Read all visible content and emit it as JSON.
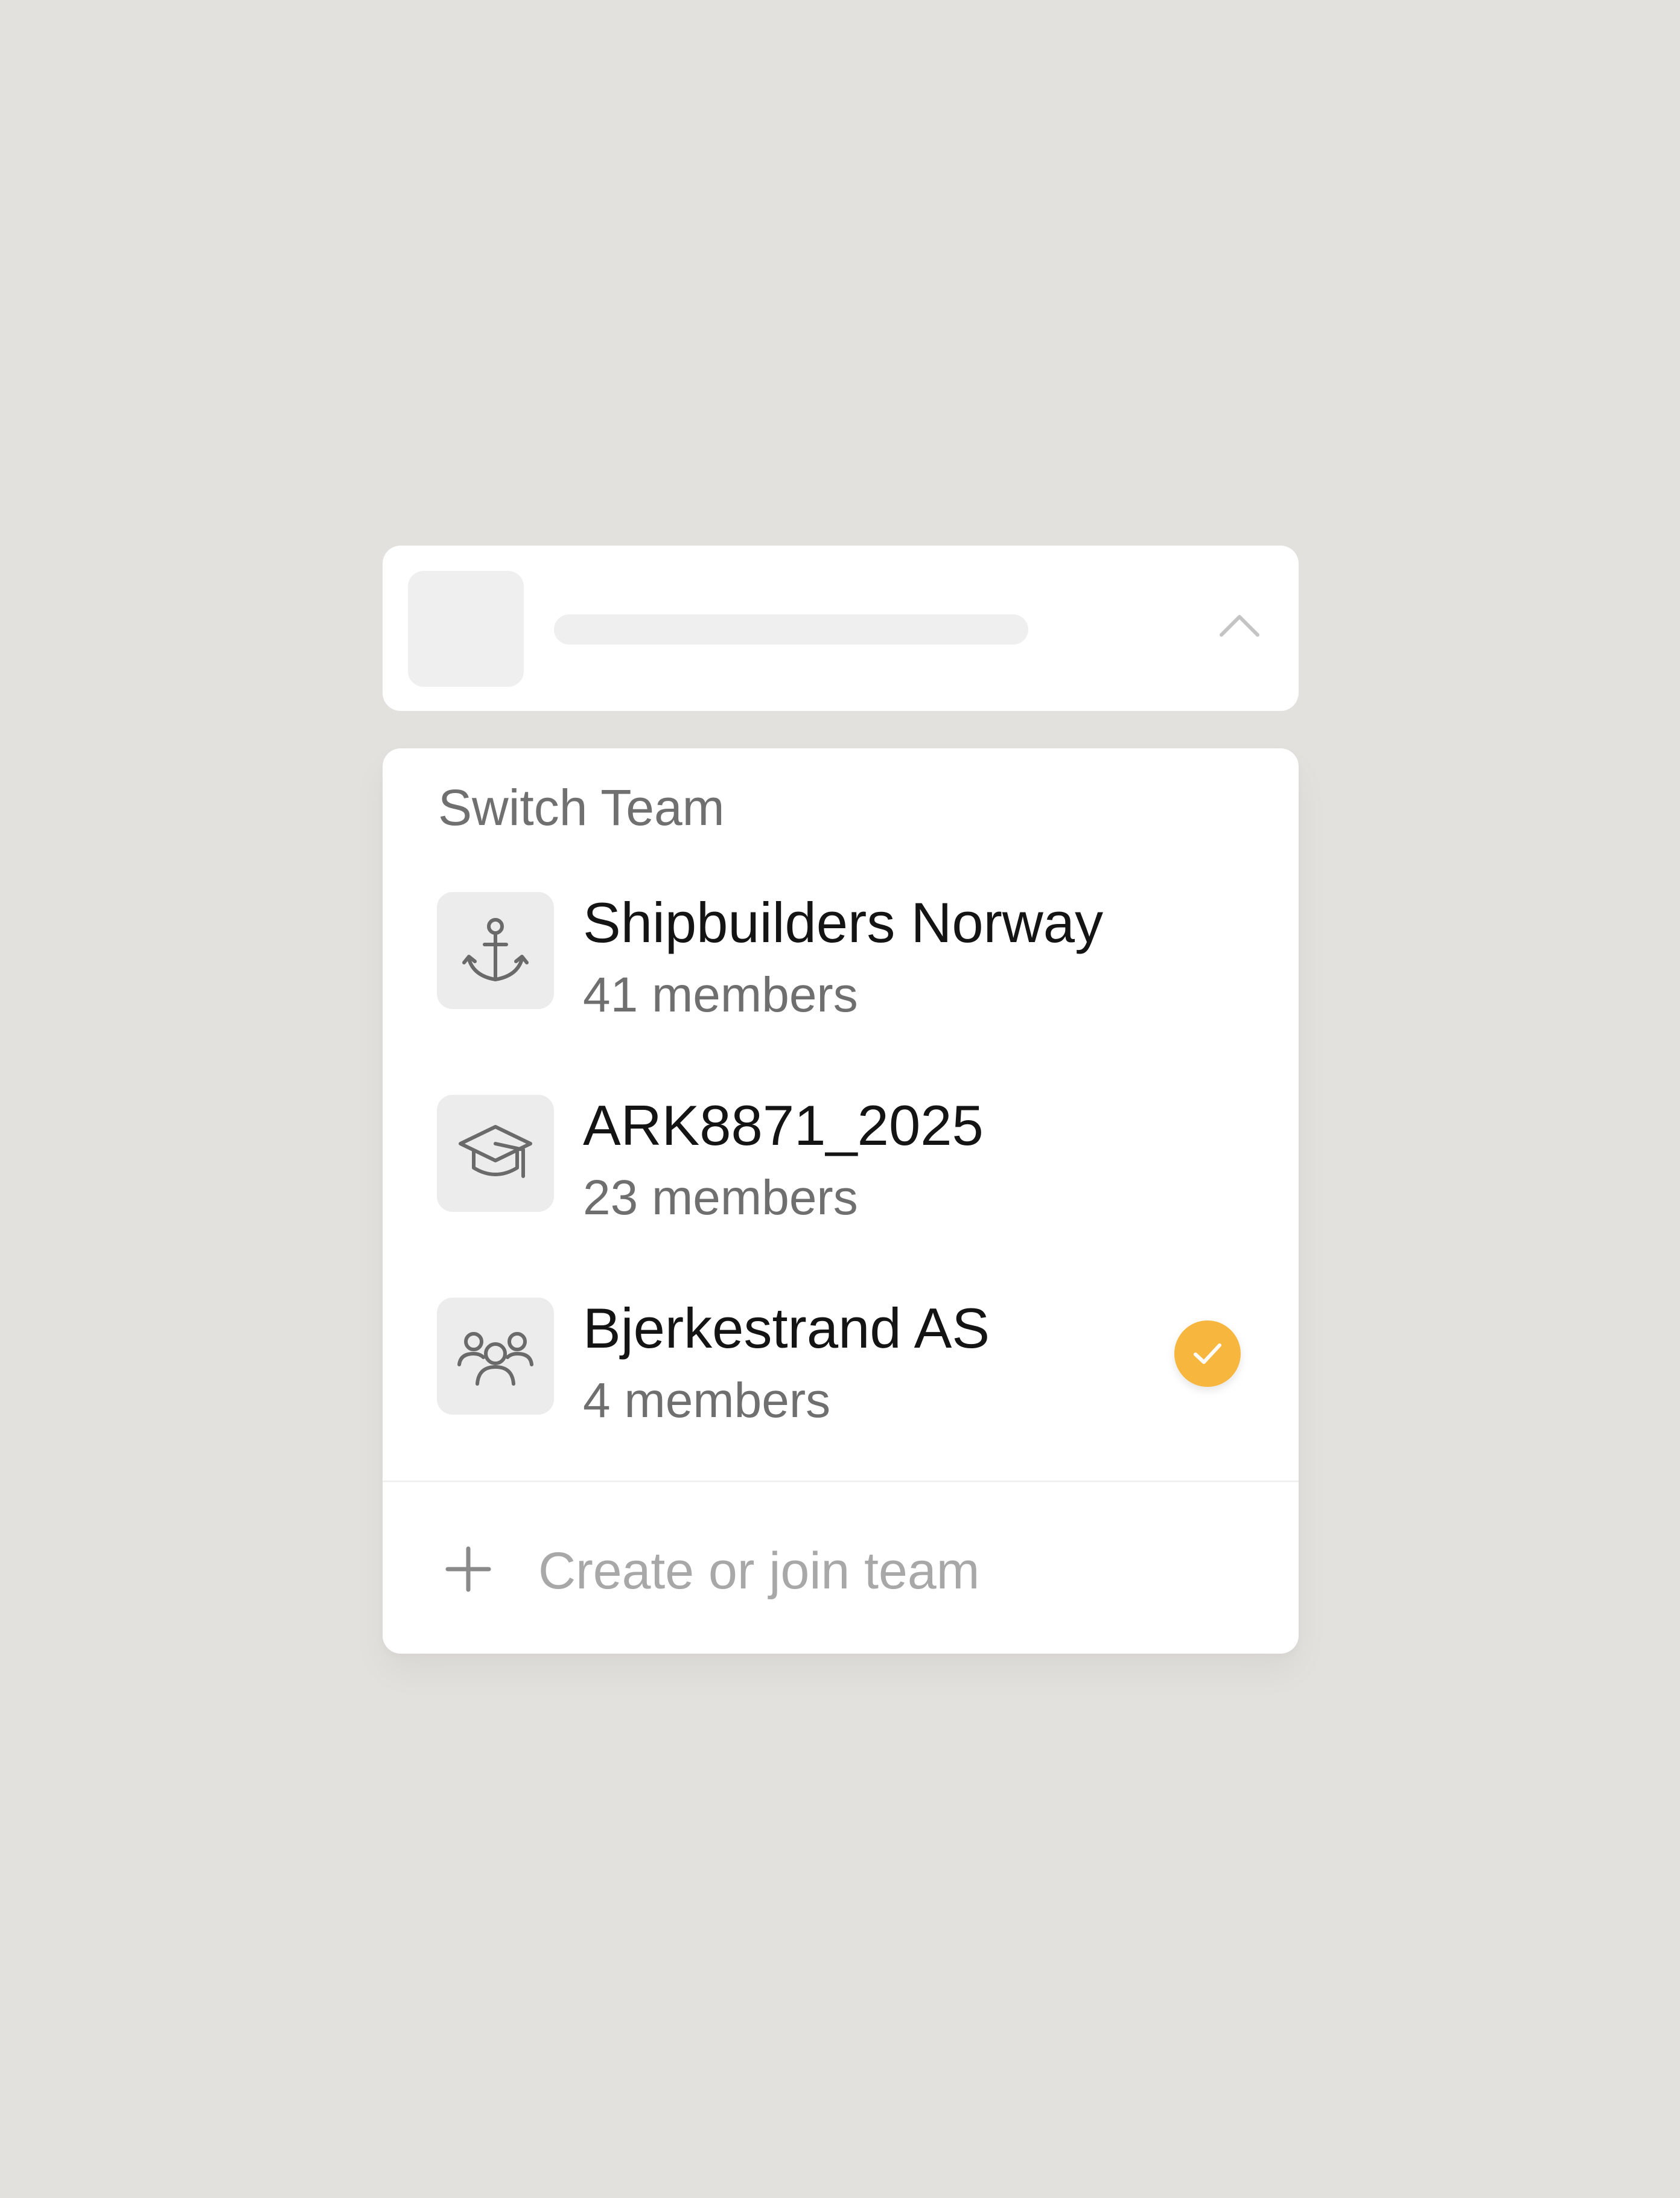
{
  "selector": {
    "chevron_icon": "chevron-up-icon"
  },
  "dropdown": {
    "heading": "Switch Team",
    "teams": [
      {
        "name": "Shipbuilders Norway",
        "members": "41 members",
        "icon": "anchor-icon",
        "selected": false
      },
      {
        "name": "ARK8871_2025",
        "members": "23 members",
        "icon": "graduation-cap-icon",
        "selected": false
      },
      {
        "name": "Bjerkestrand AS",
        "members": "4 members",
        "icon": "users-icon",
        "selected": true
      }
    ],
    "create_label": "Create or join team",
    "create_icon": "plus-icon"
  },
  "colors": {
    "background": "#e2e1dd",
    "accent": "#f7b63e",
    "text_primary": "#141414",
    "text_secondary": "#6f6f6f",
    "text_muted": "#a8a8a8"
  }
}
